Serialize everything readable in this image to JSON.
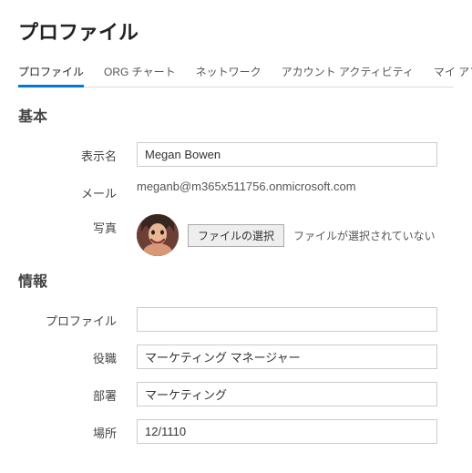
{
  "title": "プロファイル",
  "tabs": {
    "profile": "プロファイル",
    "org": "ORG チャート",
    "network": "ネットワーク",
    "activity": "アカウント アクティビティ",
    "apps": "マイ アプリケーション"
  },
  "sections": {
    "basic": "基本",
    "info": "情報"
  },
  "labels": {
    "displayName": "表示名",
    "email": "メール",
    "photo": "写真",
    "profile": "プロファイル",
    "title": "役職",
    "department": "部署",
    "location": "場所"
  },
  "values": {
    "displayName": "Megan Bowen",
    "email": "meganb@m365x511756.onmicrosoft.com",
    "profile": "",
    "title": "マーケティング マネージャー",
    "department": "マーケティング",
    "location": "12/1110"
  },
  "fileChooser": {
    "button": "ファイルの選択",
    "status": "ファイルが選択されていない"
  }
}
